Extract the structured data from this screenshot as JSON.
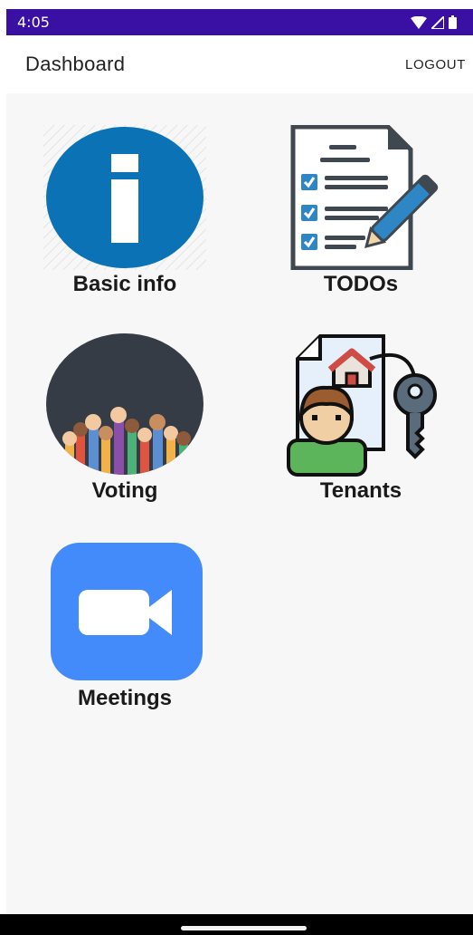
{
  "status": {
    "time": "4:05"
  },
  "appbar": {
    "title": "Dashboard",
    "logout_label": "LOGOUT"
  },
  "tiles": [
    {
      "label": "Basic info",
      "icon": "info-icon"
    },
    {
      "label": "TODOs",
      "icon": "todo-checklist-icon"
    },
    {
      "label": "Voting",
      "icon": "raised-hands-icon"
    },
    {
      "label": "Tenants",
      "icon": "tenant-house-key-icon"
    },
    {
      "label": "Meetings",
      "icon": "video-camera-icon"
    }
  ],
  "colors": {
    "status_bar": "#3a0fa3",
    "info_blue": "#0a72b5",
    "meetings_blue": "#438afb",
    "content_bg": "#f7f7f7"
  }
}
